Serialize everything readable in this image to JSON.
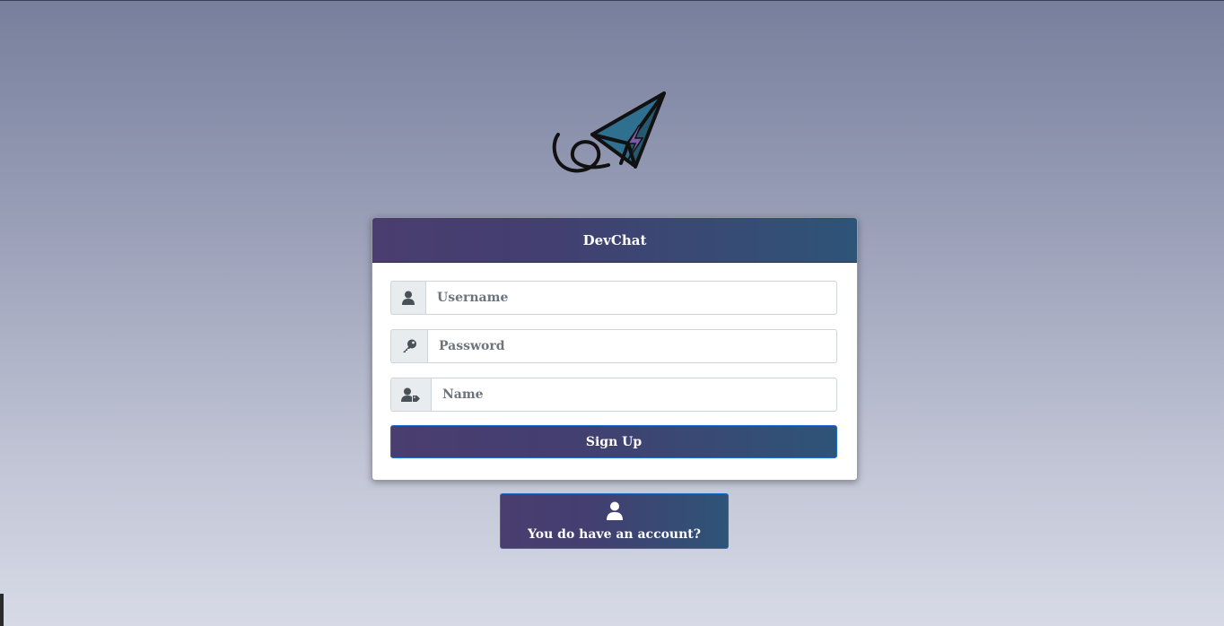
{
  "app": {
    "logo_icon": "paper-plane-logo-icon"
  },
  "card": {
    "title": "DevChat"
  },
  "form": {
    "username": {
      "placeholder": "Username",
      "value": "",
      "icon": "user-icon"
    },
    "password": {
      "placeholder": "Password",
      "value": "",
      "icon": "key-icon"
    },
    "name": {
      "placeholder": "Name",
      "value": "",
      "icon": "user-tag-icon"
    },
    "submit_label": "Sign Up"
  },
  "secondary": {
    "label": "You do have an account?",
    "icon": "user-icon"
  },
  "colors": {
    "header_gradient_start": "#4a3d6f",
    "header_gradient_end": "#2e5478",
    "button_border": "#1d6fd6",
    "plane_fill": "#2e6e8e",
    "bolt_fill": "#7b5aa6"
  }
}
